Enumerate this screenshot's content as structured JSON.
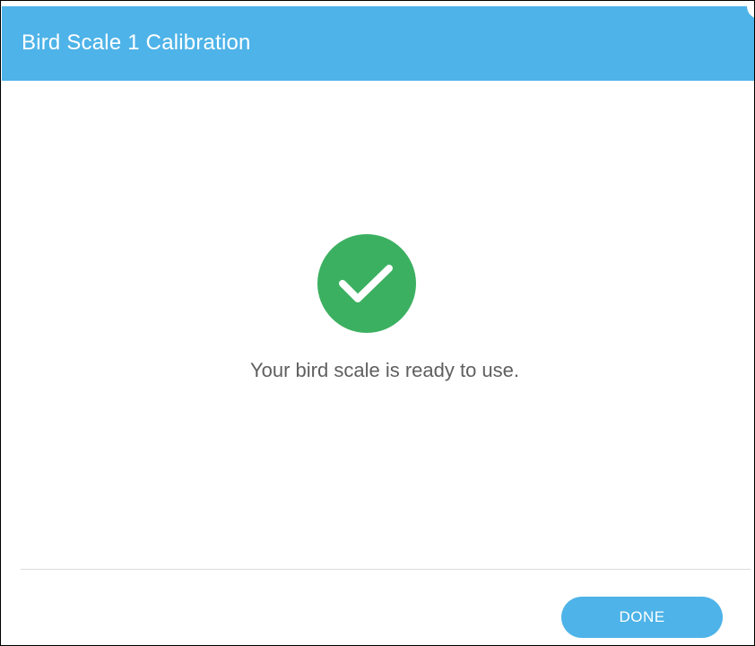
{
  "dialog": {
    "title": "Bird Scale 1 Calibration"
  },
  "status": {
    "icon": "check-icon",
    "message": "Your bird scale is ready to use."
  },
  "footer": {
    "done_label": "DONE"
  },
  "colors": {
    "header": "#4eb3e8",
    "success": "#3cb061",
    "button": "#4eb3e8",
    "message_text": "#5f5f5f"
  }
}
